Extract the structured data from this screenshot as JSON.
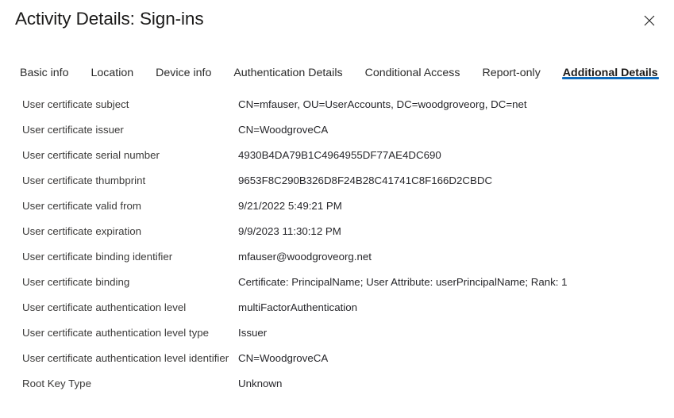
{
  "header": {
    "title": "Activity Details: Sign-ins",
    "close_icon": "close-icon",
    "close_label": "Close"
  },
  "tabs": [
    {
      "label": "Basic info",
      "active": false
    },
    {
      "label": "Location",
      "active": false
    },
    {
      "label": "Device info",
      "active": false
    },
    {
      "label": "Authentication Details",
      "active": false
    },
    {
      "label": "Conditional Access",
      "active": false
    },
    {
      "label": "Report-only",
      "active": false
    },
    {
      "label": "Additional Details",
      "active": true
    }
  ],
  "colors": {
    "accent": "#0f6cbd",
    "background": "#ffffff",
    "label_text": "#3b3a39",
    "value_text": "#26262a",
    "title_text": "#1b1a19"
  },
  "details": [
    {
      "label": "User certificate subject",
      "value": "CN=mfauser, OU=UserAccounts, DC=woodgroveorg, DC=net"
    },
    {
      "label": "User certificate issuer",
      "value": "CN=WoodgroveCA"
    },
    {
      "label": "User certificate serial number",
      "value": "4930B4DA79B1C4964955DF77AE4DC690"
    },
    {
      "label": "User certificate thumbprint",
      "value": "9653F8C290B326D8F24B28C41741C8F166D2CBDC"
    },
    {
      "label": "User certificate valid from",
      "value": "9/21/2022 5:49:21 PM"
    },
    {
      "label": "User certificate expiration",
      "value": "9/9/2023 11:30:12 PM"
    },
    {
      "label": "User certificate binding identifier",
      "value": "mfauser@woodgroveorg.net"
    },
    {
      "label": "User certificate binding",
      "value": "Certificate: PrincipalName; User Attribute: userPrincipalName; Rank: 1"
    },
    {
      "label": "User certificate authentication level",
      "value": "multiFactorAuthentication"
    },
    {
      "label": "User certificate authentication level type",
      "value": "Issuer"
    },
    {
      "label": "User certificate authentication level identifier",
      "value": "CN=WoodgroveCA"
    },
    {
      "label": "Root Key Type",
      "value": "Unknown"
    }
  ]
}
